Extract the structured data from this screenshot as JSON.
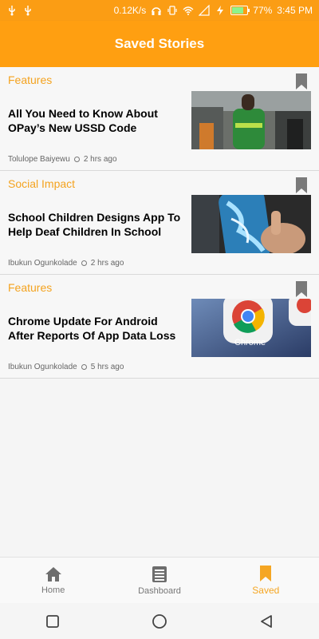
{
  "status_bar": {
    "speed": "0.12K/s",
    "battery_percent": "77%",
    "time": "3:45 PM"
  },
  "header": {
    "title": "Saved Stories"
  },
  "stories": [
    {
      "category": "Features",
      "title": "All You Need to Know About OPay’s New USSD Code",
      "author": "Tolulope Baiyewu",
      "time_ago": "2 hrs ago"
    },
    {
      "category": "Social Impact",
      "title": "School Children Designs App To Help Deaf Children In School",
      "author": "Ibukun Ogunkolade",
      "time_ago": "2 hrs ago"
    },
    {
      "category": "Features",
      "title": "Chrome Update For Android After Reports Of App Data Loss",
      "author": "Ibukun Ogunkolade",
      "time_ago": "5 hrs ago"
    }
  ],
  "chrome_image": {
    "label": "Chrome"
  },
  "bottom_nav": {
    "items": [
      {
        "label": "Home",
        "icon": "home-icon"
      },
      {
        "label": "Dashboard",
        "icon": "dashboard-icon"
      },
      {
        "label": "Saved",
        "icon": "bookmark-icon"
      }
    ],
    "active": "Saved"
  },
  "colors": {
    "accent": "#ff9f11",
    "category": "#f4a31f",
    "active_nav": "#f5a623"
  }
}
